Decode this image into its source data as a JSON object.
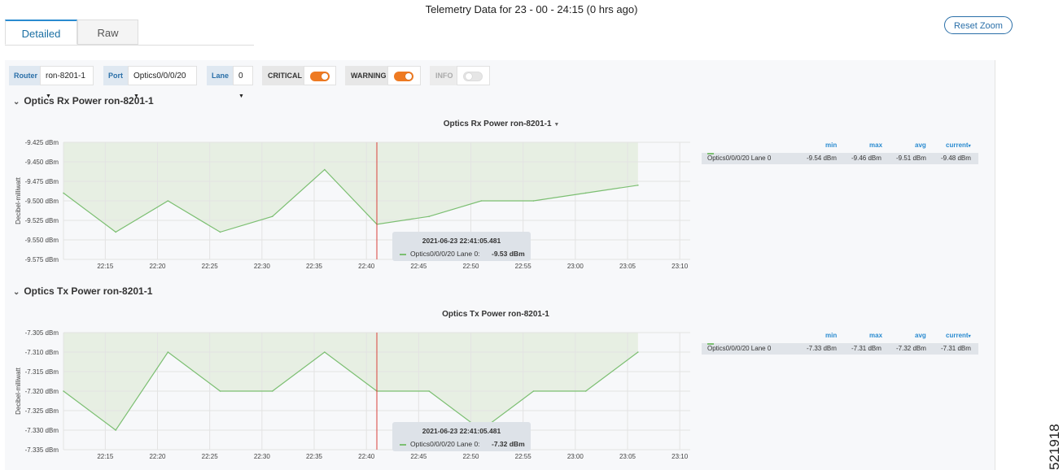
{
  "page": {
    "title": "Telemetry Data for 23 - 00 - 24:15 (0 hrs ago)",
    "reset_zoom": "Reset Zoom",
    "vertical_id": "521918"
  },
  "tabs": [
    {
      "label": "Detailed",
      "active": true
    },
    {
      "label": "Raw",
      "active": false
    }
  ],
  "filters": {
    "router_label": "Router",
    "router_value": "ron-8201-1",
    "port_label": "Port",
    "port_value": "Optics0/0/0/20",
    "lane_label": "Lane",
    "lane_value": "0",
    "critical_label": "CRITICAL",
    "critical_on": true,
    "warning_label": "WARNING",
    "warning_on": true,
    "info_label": "INFO",
    "info_on": false
  },
  "colors": {
    "accent": "#2a8bd0",
    "toggle_on": "#ee7a22",
    "series": "#7cbf72",
    "area_fill": "#e7efe3",
    "cursor_line": "#d9413b"
  },
  "icons": {
    "dropdown": "chevron-down-icon",
    "section": "collapse-chevron-icon"
  },
  "sections": [
    {
      "title": "Optics Rx Power ron-8201-1",
      "chart_title": "Optics Rx Power ron-8201-1"
    },
    {
      "title": "Optics Tx Power ron-8201-1",
      "chart_title": "Optics Tx Power ron-8201-1"
    }
  ],
  "legends": [
    {
      "headers": [
        "min",
        "max",
        "avg",
        "current"
      ],
      "series": "Optics0/0/0/20 Lane 0",
      "min": "-9.54 dBm",
      "max": "-9.46 dBm",
      "avg": "-9.51 dBm",
      "current": "-9.48 dBm"
    },
    {
      "headers": [
        "min",
        "max",
        "avg",
        "current"
      ],
      "series": "Optics0/0/0/20 Lane 0",
      "min": "-7.33 dBm",
      "max": "-7.31 dBm",
      "avg": "-7.32 dBm",
      "current": "-7.31 dBm"
    }
  ],
  "tooltips": [
    {
      "time": "2021-06-23 22:41:05.481",
      "series": "Optics0/0/0/20 Lane 0:",
      "value": "-9.53 dBm"
    },
    {
      "time": "2021-06-23 22:41:05.481",
      "series": "Optics0/0/0/20 Lane 0:",
      "value": "-7.32 dBm"
    }
  ],
  "chart_data": [
    {
      "type": "area",
      "title": "Optics Rx Power ron-8201-1",
      "ylabel": "Decibel-milliwatt",
      "xlabel": "",
      "x_ticks": [
        "22:15",
        "22:20",
        "22:25",
        "22:30",
        "22:35",
        "22:40",
        "22:45",
        "22:50",
        "22:55",
        "23:00",
        "23:05",
        "23:10"
      ],
      "y_ticks": [
        "-9.425 dBm",
        "-9.450 dBm",
        "-9.475 dBm",
        "-9.500 dBm",
        "-9.525 dBm",
        "-9.550 dBm",
        "-9.575 dBm"
      ],
      "ylim": [
        -9.575,
        -9.425
      ],
      "xlim_minutes": [
        "22:11",
        "23:11"
      ],
      "cursor_time": "22:41",
      "series": [
        {
          "name": "Optics0/0/0/20 Lane 0",
          "x": [
            "22:11",
            "22:16",
            "22:21",
            "22:26",
            "22:31",
            "22:36",
            "22:41",
            "22:46",
            "22:51",
            "22:56",
            "23:01",
            "23:06"
          ],
          "values": [
            -9.49,
            -9.54,
            -9.5,
            -9.54,
            -9.52,
            -9.46,
            -9.53,
            -9.52,
            -9.5,
            -9.5,
            -9.49,
            -9.48
          ]
        }
      ],
      "grid": true,
      "legend": "right"
    },
    {
      "type": "area",
      "title": "Optics Tx Power ron-8201-1",
      "ylabel": "Decibel-milliwatt",
      "xlabel": "",
      "x_ticks": [
        "22:15",
        "22:20",
        "22:25",
        "22:30",
        "22:35",
        "22:40",
        "22:45",
        "22:50",
        "22:55",
        "23:00",
        "23:05",
        "23:10"
      ],
      "y_ticks": [
        "-7.305 dBm",
        "-7.310 dBm",
        "-7.315 dBm",
        "-7.320 dBm",
        "-7.325 dBm",
        "-7.330 dBm",
        "-7.335 dBm"
      ],
      "ylim": [
        -7.335,
        -7.305
      ],
      "xlim_minutes": [
        "22:11",
        "23:11"
      ],
      "cursor_time": "22:41",
      "series": [
        {
          "name": "Optics0/0/0/20 Lane 0",
          "x": [
            "22:11",
            "22:16",
            "22:21",
            "22:26",
            "22:31",
            "22:36",
            "22:41",
            "22:46",
            "22:51",
            "22:56",
            "23:01",
            "23:06"
          ],
          "values": [
            -7.32,
            -7.33,
            -7.31,
            -7.32,
            -7.32,
            -7.31,
            -7.32,
            -7.32,
            -7.33,
            -7.32,
            -7.32,
            -7.31
          ]
        }
      ],
      "grid": true,
      "legend": "right"
    }
  ]
}
